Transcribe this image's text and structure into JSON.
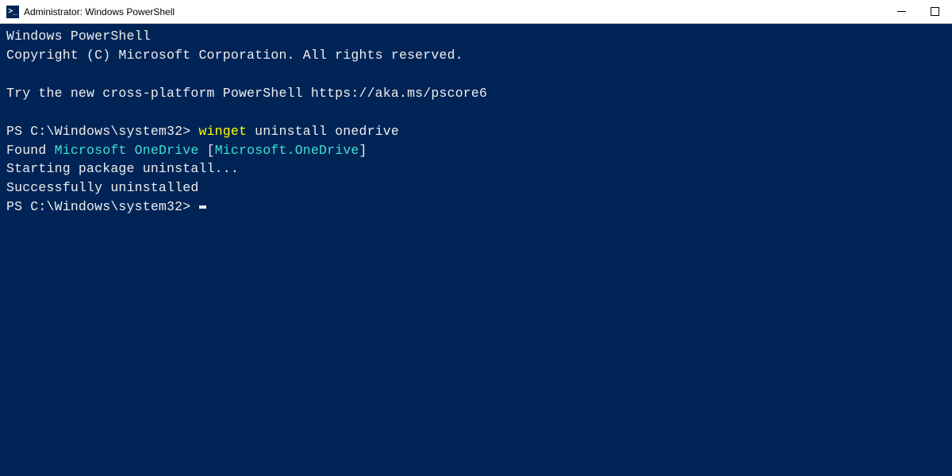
{
  "titlebar": {
    "icon_glyph": ">_",
    "title": "Administrator: Windows PowerShell"
  },
  "terminal": {
    "banner_line1": "Windows PowerShell",
    "banner_line2": "Copyright (C) Microsoft Corporation. All rights reserved.",
    "banner_line3": "Try the new cross-platform PowerShell https://aka.ms/pscore6",
    "prompt1_prefix": "PS C:\\Windows\\system32> ",
    "prompt1_cmd_highlight": "winget",
    "prompt1_cmd_rest": " uninstall onedrive",
    "found_prefix": "Found ",
    "found_name": "Microsoft OneDrive",
    "found_open_bracket": " [",
    "found_id": "Microsoft.OneDrive",
    "found_close_bracket": "]",
    "status_line1": "Starting package uninstall...",
    "status_line2": "Successfully uninstalled",
    "prompt2_prefix": "PS C:\\Windows\\system32> "
  }
}
